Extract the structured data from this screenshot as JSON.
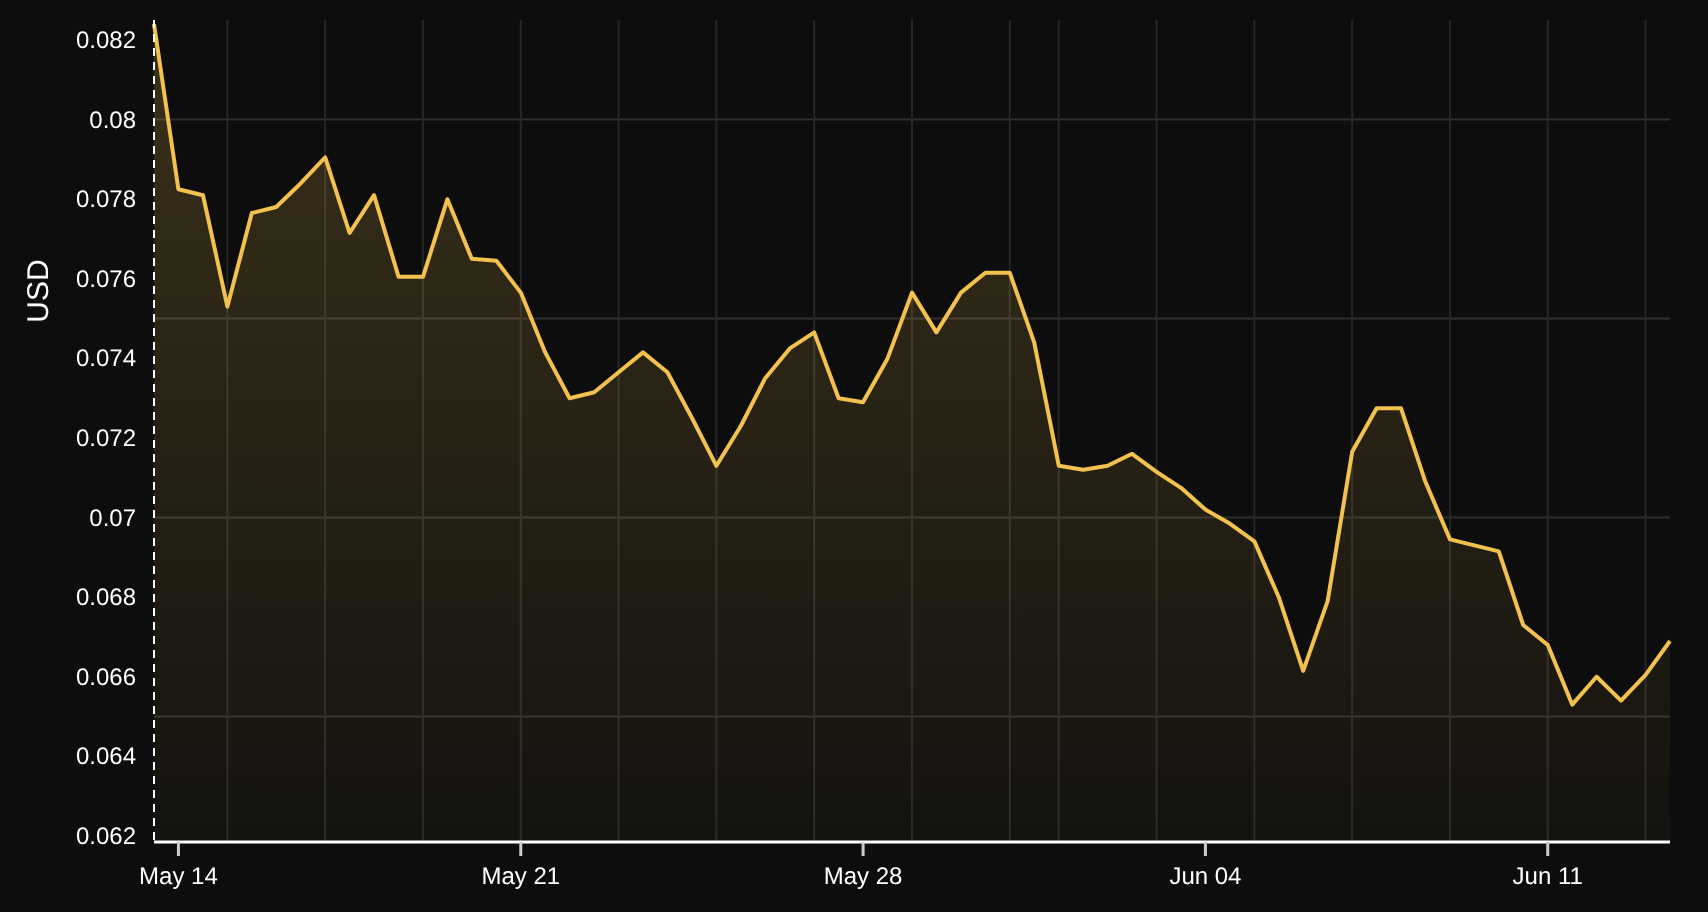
{
  "chart_data": {
    "type": "area",
    "ylabel": "USD",
    "categories": [
      null,
      "May 14",
      null,
      null,
      null,
      null,
      null,
      null,
      null,
      null,
      null,
      null,
      null,
      null,
      null,
      "May 21",
      null,
      null,
      null,
      null,
      null,
      null,
      null,
      null,
      null,
      null,
      null,
      null,
      null,
      "May 28",
      null,
      null,
      null,
      null,
      null,
      null,
      null,
      null,
      null,
      null,
      null,
      null,
      null,
      "Jun 04",
      null,
      null,
      null,
      null,
      null,
      null,
      null,
      null,
      null,
      null,
      null,
      null,
      null,
      "Jun 11",
      null,
      null,
      null,
      null,
      null
    ],
    "series": [
      {
        "color": "#f2c14e",
        "values": [
          0.0824,
          0.07825,
          0.0781,
          0.0753,
          0.07765,
          0.0778,
          0.0784,
          0.07905,
          0.07715,
          0.0781,
          0.07605,
          0.07605,
          0.078,
          0.0765,
          0.07645,
          0.07565,
          0.07415,
          0.073,
          0.07315,
          0.07365,
          0.07415,
          0.07365,
          0.0725,
          0.0713,
          0.0723,
          0.0735,
          0.07425,
          0.07465,
          0.073,
          0.0729,
          0.074,
          0.07565,
          0.07465,
          0.07565,
          0.07615,
          0.07615,
          0.0744,
          0.0713,
          0.0712,
          0.0713,
          0.0716,
          0.07115,
          0.07075,
          0.0702,
          0.06985,
          0.0694,
          0.068,
          0.06615,
          0.0679,
          0.07165,
          0.07275,
          0.07275,
          0.0709,
          0.06945,
          0.0693,
          0.06915,
          0.0673,
          0.0668,
          0.0653,
          0.066,
          0.0654,
          0.06605,
          0.0669
        ]
      }
    ],
    "ylim": [
      0.06185,
      0.0825
    ],
    "grid": true,
    "yticks": [
      {
        "value": 0.062,
        "label": "0.062"
      },
      {
        "value": 0.064,
        "label": "0.064"
      },
      {
        "value": 0.066,
        "label": "0.066"
      },
      {
        "value": 0.068,
        "label": "0.068"
      },
      {
        "value": 0.07,
        "label": "0.07"
      },
      {
        "value": 0.072,
        "label": "0.072"
      },
      {
        "value": 0.074,
        "label": "0.074"
      },
      {
        "value": 0.076,
        "label": "0.076"
      },
      {
        "value": 0.078,
        "label": "0.078"
      },
      {
        "value": 0.08,
        "label": "0.08"
      },
      {
        "value": 0.082,
        "label": "0.082"
      }
    ]
  }
}
